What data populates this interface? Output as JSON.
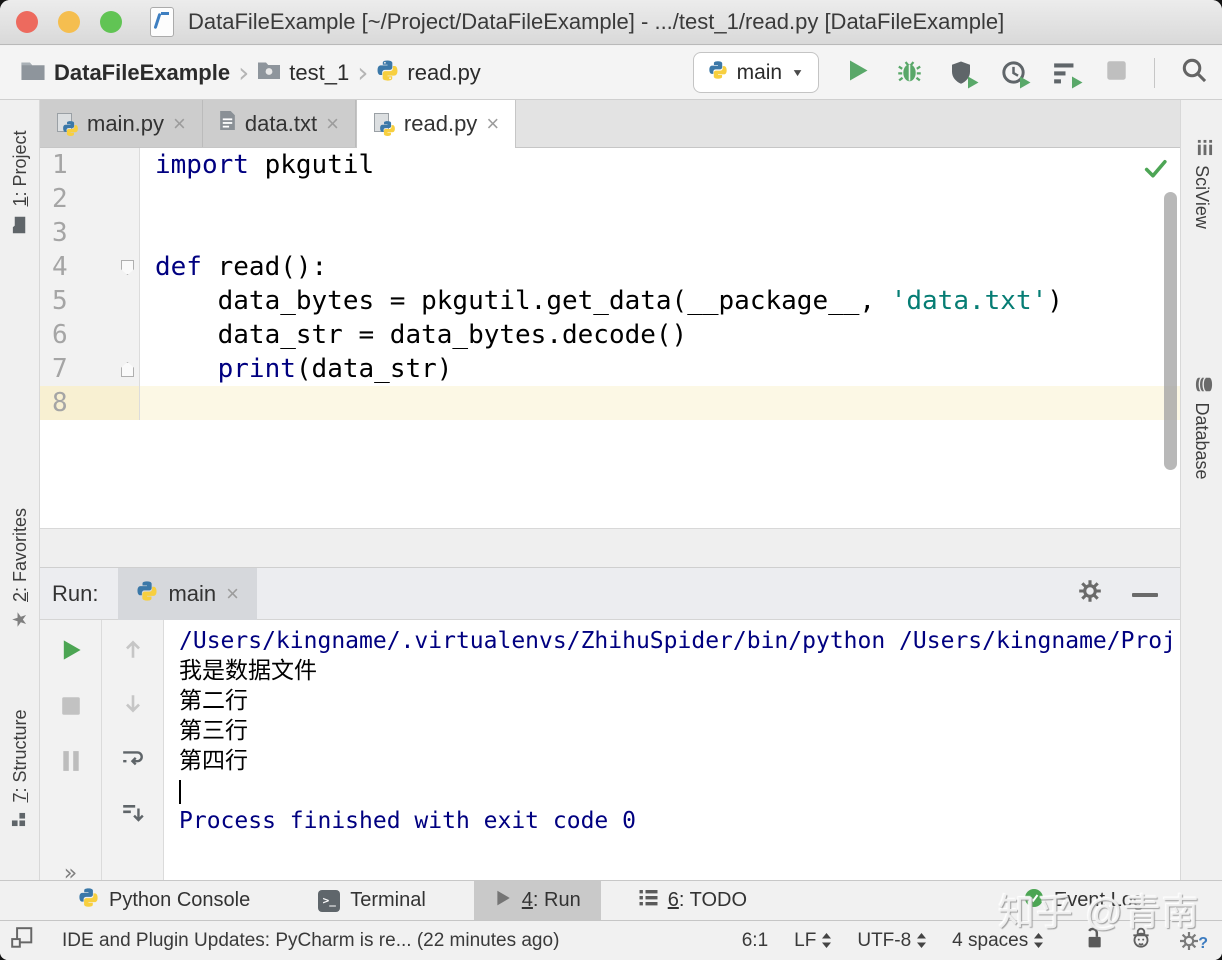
{
  "colors": {
    "keyword": "#000080",
    "string": "#067D74",
    "console_system": "#000080",
    "caret_line": "#FCF8E5",
    "run_green": "#59A869",
    "debug_green": "#59A869",
    "traffic_red": "#ED6A5E",
    "traffic_yellow": "#F5BE4F",
    "traffic_green": "#61C454"
  },
  "icons": {
    "close": "×",
    "breadcrumb_sep": "›",
    "dropdown": "▼",
    "double_chevron": "»",
    "star": "★"
  },
  "window_title": "DataFileExample [~/Project/DataFileExample] - .../test_1/read.py [DataFileExample]",
  "breadcrumbs": {
    "project": "DataFileExample",
    "dir": "test_1",
    "file": "read.py"
  },
  "run_config": "main",
  "tabs": {
    "tab1": "main.py",
    "tab2": "data.txt",
    "tab3": "read.py"
  },
  "line_numbers": [
    "1",
    "2",
    "3",
    "4",
    "5",
    "6",
    "7",
    "8"
  ],
  "code": {
    "l1_kw": "import",
    "l1_rest": " pkgutil",
    "l4_kw": "def",
    "l4_rest": " read():",
    "l5_pre": "    data_bytes = pkgutil.get_data(__package__, ",
    "l5_str": "'data.txt'",
    "l5_post": ")",
    "l6": "    data_str = data_bytes.decode()",
    "l7_pre": "    ",
    "l7_kw": "print",
    "l7_rest": "(data_str)"
  },
  "left_rail": {
    "project_num": "1",
    "project_rest": ": Project",
    "fav_num": "2",
    "fav_rest": ": Favorites",
    "struct_num": "7",
    "struct_rest": ": Structure"
  },
  "right_rail": {
    "sciview": "SciView",
    "database": "Database"
  },
  "run_panel": {
    "label": "Run:",
    "tab": "main"
  },
  "console": {
    "command": "/Users/kingname/.virtualenvs/ZhihuSpider/bin/python /Users/kingname/Proj",
    "out1": "我是数据文件",
    "out2": "第二行",
    "out3": "第三行",
    "out4": "第四行",
    "exit": "Process finished with exit code 0"
  },
  "bottom_bar": {
    "python_console": "Python Console",
    "terminal": "Terminal",
    "run_num": "4",
    "run_rest": ": Run",
    "todo_num": "6",
    "todo_rest": ": TODO",
    "event_log": "Event Log"
  },
  "status_bar": {
    "message": "IDE and Plugin Updates: PyCharm is re... (22 minutes ago)",
    "position": "6:1",
    "line_sep": "LF",
    "encoding": "UTF-8",
    "indent": "4 spaces"
  },
  "watermark": "知乎 @青南"
}
